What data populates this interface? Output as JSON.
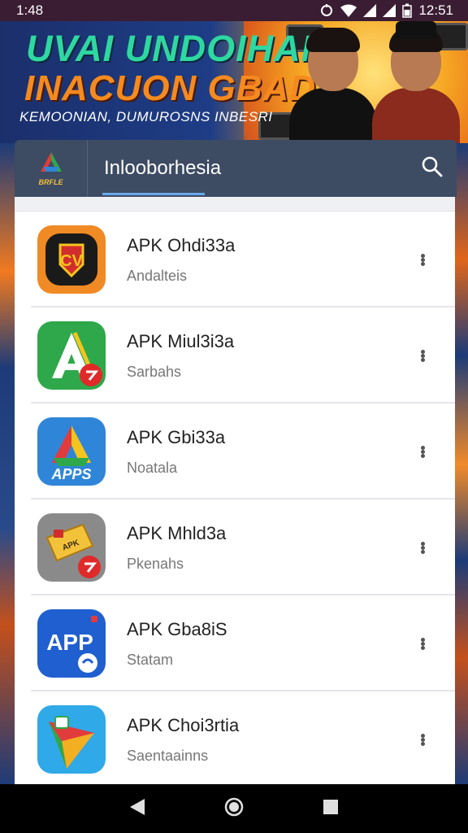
{
  "status_bar": {
    "time_left": "1:48",
    "time_right": "12:51",
    "icons": [
      "sync-icon",
      "wifi-icon",
      "signal-icon",
      "signal-icon",
      "battery-icon"
    ]
  },
  "banner": {
    "line1": "UVAI UNDOIHAN",
    "line2": "INACUON GBAD",
    "line3": "KEMOONIAN, DUMUROSNS INBESRI"
  },
  "app_bar": {
    "logo_text": "BRFLE",
    "title": "Inlooborhesia",
    "search_icon": "search-icon"
  },
  "apps": [
    {
      "name": "APK Ohdi33a",
      "subtitle": "Andalteis",
      "icon": "shield-badge-icon",
      "colors": [
        "#f08a24",
        "#1a1a1a"
      ]
    },
    {
      "name": "APK Miul3i3a",
      "subtitle": "Sarbahs",
      "icon": "letter-a-icon",
      "colors": [
        "#2ea84a",
        "#ffffff"
      ]
    },
    {
      "name": "APK Gbi33a",
      "subtitle": "Noatala",
      "icon": "apps-icon",
      "colors": [
        "#2f86d8",
        "#f5c41e"
      ]
    },
    {
      "name": "APK Mhld3a",
      "subtitle": "Pkenahs",
      "icon": "flag-icon",
      "colors": [
        "#7a7a7a",
        "#f2c33a"
      ]
    },
    {
      "name": "APK Gba8iS",
      "subtitle": "Statam",
      "icon": "app-text-icon",
      "colors": [
        "#1f5fd0",
        "#ffffff"
      ]
    },
    {
      "name": "APK Choi3rtia",
      "subtitle": "Saentaainns",
      "icon": "paper-plane-icon",
      "colors": [
        "#2fa9e8",
        "#e23b3b"
      ]
    }
  ],
  "nav_bar": {
    "icons": [
      "back-icon",
      "home-icon",
      "recents-icon"
    ]
  }
}
